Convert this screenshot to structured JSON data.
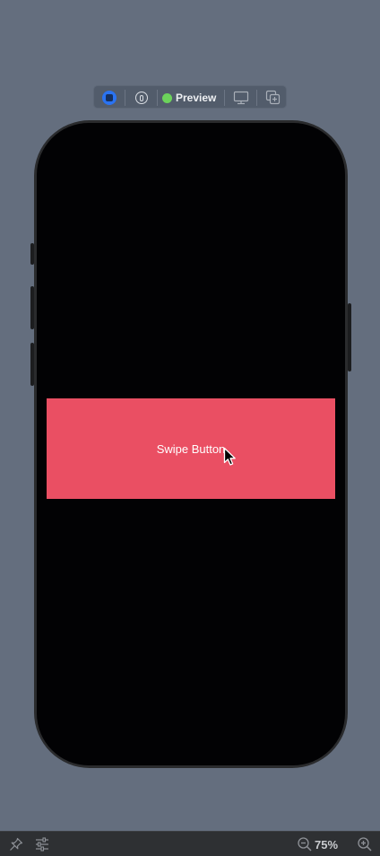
{
  "toolbar": {
    "live_icon": "live-preview-icon",
    "selectable_icon": "selectable-mode-icon",
    "preview_label": "Preview",
    "preview_status_color": "#6cd35b",
    "device_icon": "device-settings-icon",
    "duplicate_icon": "duplicate-preview-icon"
  },
  "app": {
    "swipe_button_label": "Swipe Button",
    "swipe_button_color": "#ea4f63",
    "screen_background": "#020204"
  },
  "bottom_bar": {
    "pin_icon": "pin-icon",
    "adjust_icon": "adjust-settings-icon",
    "zoom_out_icon": "zoom-out-icon",
    "zoom_level": "75%",
    "zoom_in_icon": "zoom-in-icon"
  }
}
